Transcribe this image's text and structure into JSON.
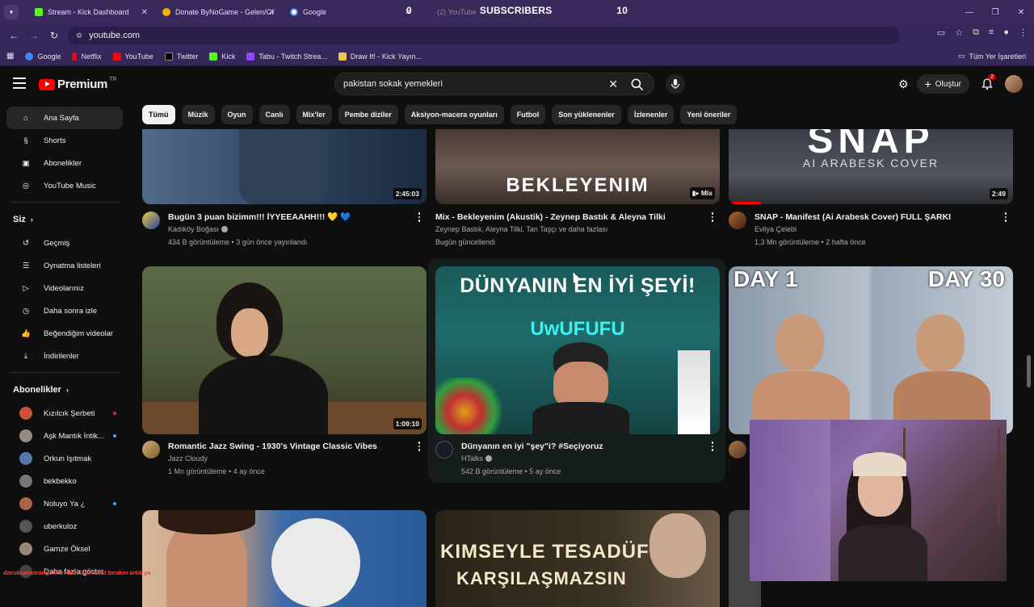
{
  "browser": {
    "tabs": [
      {
        "label": "Stream - Kick Dashboard",
        "color": "#53fc18"
      },
      {
        "label": "Donate ByNoGame - Gelen/Gid",
        "color": "#f0b400"
      },
      {
        "label": "Google",
        "color": "#4285f4"
      },
      {
        "label": "(2) YouTube",
        "color": "#ff0000"
      }
    ],
    "overlay": {
      "prefix": "0",
      "title": "SUBSCRIBERS",
      "count": "10"
    },
    "url": "youtube.com",
    "bookmarks": [
      "Google",
      "Netflix",
      "YouTube",
      "Twitter",
      "Kick",
      "Tabu - Twitch Strea...",
      "Draw It! - Kick Yayın..."
    ],
    "bookmarks_right": "Tüm Yer İşaretleri"
  },
  "youtube": {
    "logo": "Premium",
    "logo_region": "TR",
    "search_value": "pakistan sokak yemekleri",
    "create_label": "Oluştur",
    "notif_count": "2"
  },
  "sidebar": {
    "main": [
      {
        "label": "Ana Sayfa",
        "icon": "home-icon"
      },
      {
        "label": "Shorts",
        "icon": "shorts-icon"
      },
      {
        "label": "Abonelikler",
        "icon": "subscriptions-icon"
      },
      {
        "label": "YouTube Music",
        "icon": "music-icon"
      }
    ],
    "you_header": "Siz",
    "you": [
      {
        "label": "Geçmiş",
        "icon": "history-icon"
      },
      {
        "label": "Oynatma listeleri",
        "icon": "playlists-icon"
      },
      {
        "label": "Videolarınız",
        "icon": "your-videos-icon"
      },
      {
        "label": "Daha sonra izle",
        "icon": "watch-later-icon"
      },
      {
        "label": "Beğendiğim videolar",
        "icon": "liked-icon"
      },
      {
        "label": "İndirilenler",
        "icon": "download-icon"
      }
    ],
    "subs_header": "Abonelikler",
    "subs": [
      {
        "label": "Kızılcık Şerbeti",
        "color": "#c8533a"
      },
      {
        "label": "Aşk Mantık İntik...",
        "color": "#9a8a80"
      },
      {
        "label": "Orkun Işıtmak",
        "color": "#5577aa"
      },
      {
        "label": "bekbekko",
        "color": "#777777"
      },
      {
        "label": "Noluyo Ya ¿",
        "color": "#aa6644"
      },
      {
        "label": "uberkuloz",
        "color": "#555555"
      },
      {
        "label": "Gamze Öksel",
        "color": "#998877"
      },
      {
        "label": "Daha fazla göster",
        "color": "#444444"
      }
    ]
  },
  "chips": [
    "Tümü",
    "Müzik",
    "Oyun",
    "Canlı",
    "Mix'ler",
    "Pembe diziler",
    "Aksiyon-macera oyunları",
    "Futbol",
    "Son yüklenenler",
    "İzlenenler",
    "Yeni öneriler"
  ],
  "videos": [
    {
      "title": "Bugün 3 puan bizimm!!! İYYEEAAHH!!! 💛 💙",
      "channel": "Kadıköy Boğası",
      "stats": "434 B görüntüleme • 3 gün önce yayınlandı",
      "duration": "2:45:03"
    },
    {
      "title": "Mix - Bekleyenim (Akustik) - Zeynep Bastık & Aleyna Tilki",
      "channel": "Zeynep Bastık, Aleyna Tilki, Tan Taşçı ve daha fazlası",
      "stats": "Bugün güncellendi",
      "duration": "Mix",
      "thumb_text": "BEKLEYENIM"
    },
    {
      "title": "SNAP - Manifest (Ai Arabesk Cover) FULL ŞARKI",
      "channel": "Evliya Çelebi",
      "stats": "1,3 Mn görüntüleme • 2 hafta önce",
      "duration": "2:49",
      "thumb_text": "SNAP",
      "thumb_sub": "AI ARABESK COVER"
    },
    {
      "title": "Romantic Jazz Swing - 1930's Vintage Classic Vibes",
      "channel": "Jazz Cloudy",
      "stats": "1 Mn görüntüleme • 4 ay önce",
      "duration": "1:09:10"
    },
    {
      "title": "Dünyanın en iyi \"şey\"i? #Seçiyoruz",
      "channel": "HTalks",
      "stats": "542 B görüntüleme • 5 ay önce",
      "thumb_text": "DÜNYANIN EN İYİ ŞEYİ!",
      "thumb_sub": "UwUFUFU"
    },
    {
      "title": "",
      "channel": "",
      "stats": "",
      "thumb_text": "DAY 1",
      "thumb_sub": "DAY 30"
    },
    {
      "thumb_text": "",
      "title": "",
      "channel": "",
      "stats": ""
    },
    {
      "thumb_text": "KIMSEYLE TESADÜFEN",
      "thumb_sub": "KARŞILAŞMAZSIN",
      "title": "",
      "channel": "",
      "stats": ""
    }
  ],
  "ticker": "doruksanstrangerine: tabelayı rahat bırakın artık ya"
}
